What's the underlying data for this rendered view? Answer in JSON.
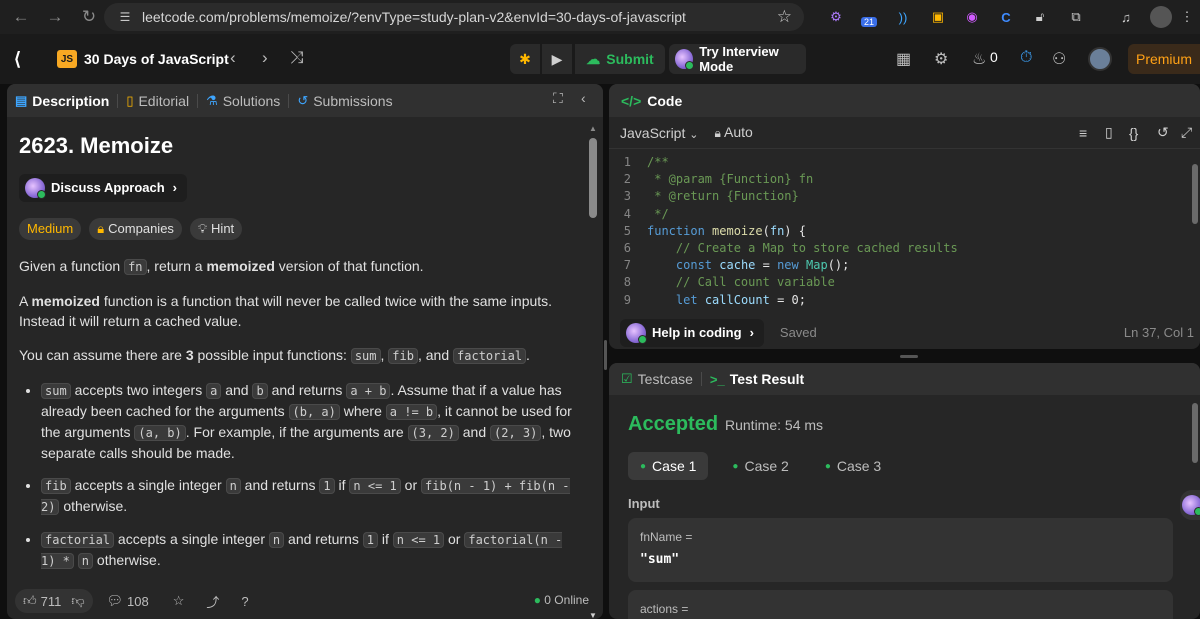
{
  "browser": {
    "url": "leetcode.com/problems/memoize/?envType=study-plan-v2&envId=30-days-of-javascript",
    "ext_badge": "21"
  },
  "app": {
    "course_badge": "JS",
    "course_title": "30 Days of JavaScript",
    "submit_label": "Submit",
    "interview_label": "Try Interview Mode",
    "streak_count": "0",
    "premium_label": "Premium"
  },
  "left": {
    "tabs": [
      "Description",
      "Editorial",
      "Solutions",
      "Submissions"
    ],
    "title": "2623. Memoize",
    "discuss_label": "Discuss Approach",
    "chips": [
      "Medium",
      "Companies",
      "Hint"
    ],
    "p1_pre": "Given a function ",
    "p1_code": "fn",
    "p1_mid": ", return a ",
    "p1_bold": "memoized",
    "p1_post": " version of that function.",
    "p2_pre": "A ",
    "p2_bold": "memoized",
    "p2_post": " function is a function that will never be called twice with the same inputs. Instead it will return a cached value.",
    "p3_pre": "You can assume there are ",
    "p3_bold": "3",
    "p3_mid": " possible input functions: ",
    "p3_c1": "sum",
    "p3_c2": "fib",
    "p3_and": ", and ",
    "p3_c3": "factorial",
    "p3_end": ".",
    "b1": {
      "c_sum": "sum",
      "t1": " accepts two integers ",
      "c_a": "a",
      "t2": " and ",
      "c_b": "b",
      "t3": " and returns ",
      "c_apb": "a + b",
      "t4": ". Assume that if a value has already been cached for the arguments ",
      "c_ba": "(b, a)",
      "t5": " where ",
      "c_neq": "a != b",
      "t6": ", it cannot be used for the arguments ",
      "c_ab": "(a, b)",
      "t7": ". For example, if the arguments are ",
      "c_32": "(3, 2)",
      "t8": " and ",
      "c_23": "(2, 3)",
      "t9": ", two separate calls should be made."
    },
    "b2": {
      "c_fib": "fib",
      "t1": " accepts a single integer ",
      "c_n": "n",
      "t2": " and returns ",
      "c_1": "1",
      "t3": " if ",
      "c_le": "n <= 1",
      "t4": "  or  ",
      "c_rec": "fib(n - 1) + fib(n - 2)",
      "t5": "  otherwise."
    },
    "b3": {
      "c_fact": "factorial",
      "t1": " accepts a single integer ",
      "c_n": "n",
      "t2": " and returns ",
      "c_1": "1",
      "t3": " if ",
      "c_le": "n <= 1",
      "t4": " or ",
      "c_rec": "factorial(n - 1) *",
      "c_n2": "n",
      "t5": " otherwise."
    },
    "likes": "711",
    "comments": "108",
    "online": "0 Online"
  },
  "code": {
    "tab_label": "Code",
    "language": "JavaScript",
    "mode": "Auto",
    "lines": [
      {
        "no": "1",
        "html": "<span class='cm'>/**</span>"
      },
      {
        "no": "2",
        "html": "<span class='cm'> * @param {Function} fn</span>"
      },
      {
        "no": "3",
        "html": "<span class='cm'> * @return {Function}</span>"
      },
      {
        "no": "4",
        "html": "<span class='cm'> */</span>"
      },
      {
        "no": "5",
        "html": "<span class='kw'>function</span> <span class='fn'>memoize</span>(<span class='vr'>fn</span>) {"
      },
      {
        "no": "6",
        "html": "    <span class='cm'>// Create a Map to store cached results</span>"
      },
      {
        "no": "7",
        "html": "    <span class='kw'>const</span> <span class='vr'>cache</span> = <span class='kw'>new</span> <span class='cl'>Map</span>();"
      },
      {
        "no": "8",
        "html": "    <span class='cm'>// Call count variable</span>"
      },
      {
        "no": "9",
        "html": "    <span class='kw'>let</span> <span class='vr'>callCount</span> = 0;"
      }
    ],
    "help_label": "Help in coding",
    "saved": "Saved",
    "cursor": "Ln 37, Col 1"
  },
  "result": {
    "tabs": [
      "Testcase",
      "Test Result"
    ],
    "status": "Accepted",
    "runtime": "Runtime: 54 ms",
    "cases": [
      "Case 1",
      "Case 2",
      "Case 3"
    ],
    "input_label": "Input",
    "fields": [
      {
        "name": "fnName =",
        "value": "\"sum\""
      },
      {
        "name": "actions =",
        "value": ""
      }
    ]
  },
  "colors": {
    "accent_green": "#2cbb5d",
    "medium": "#ffb800",
    "premium": "#ffa116"
  }
}
